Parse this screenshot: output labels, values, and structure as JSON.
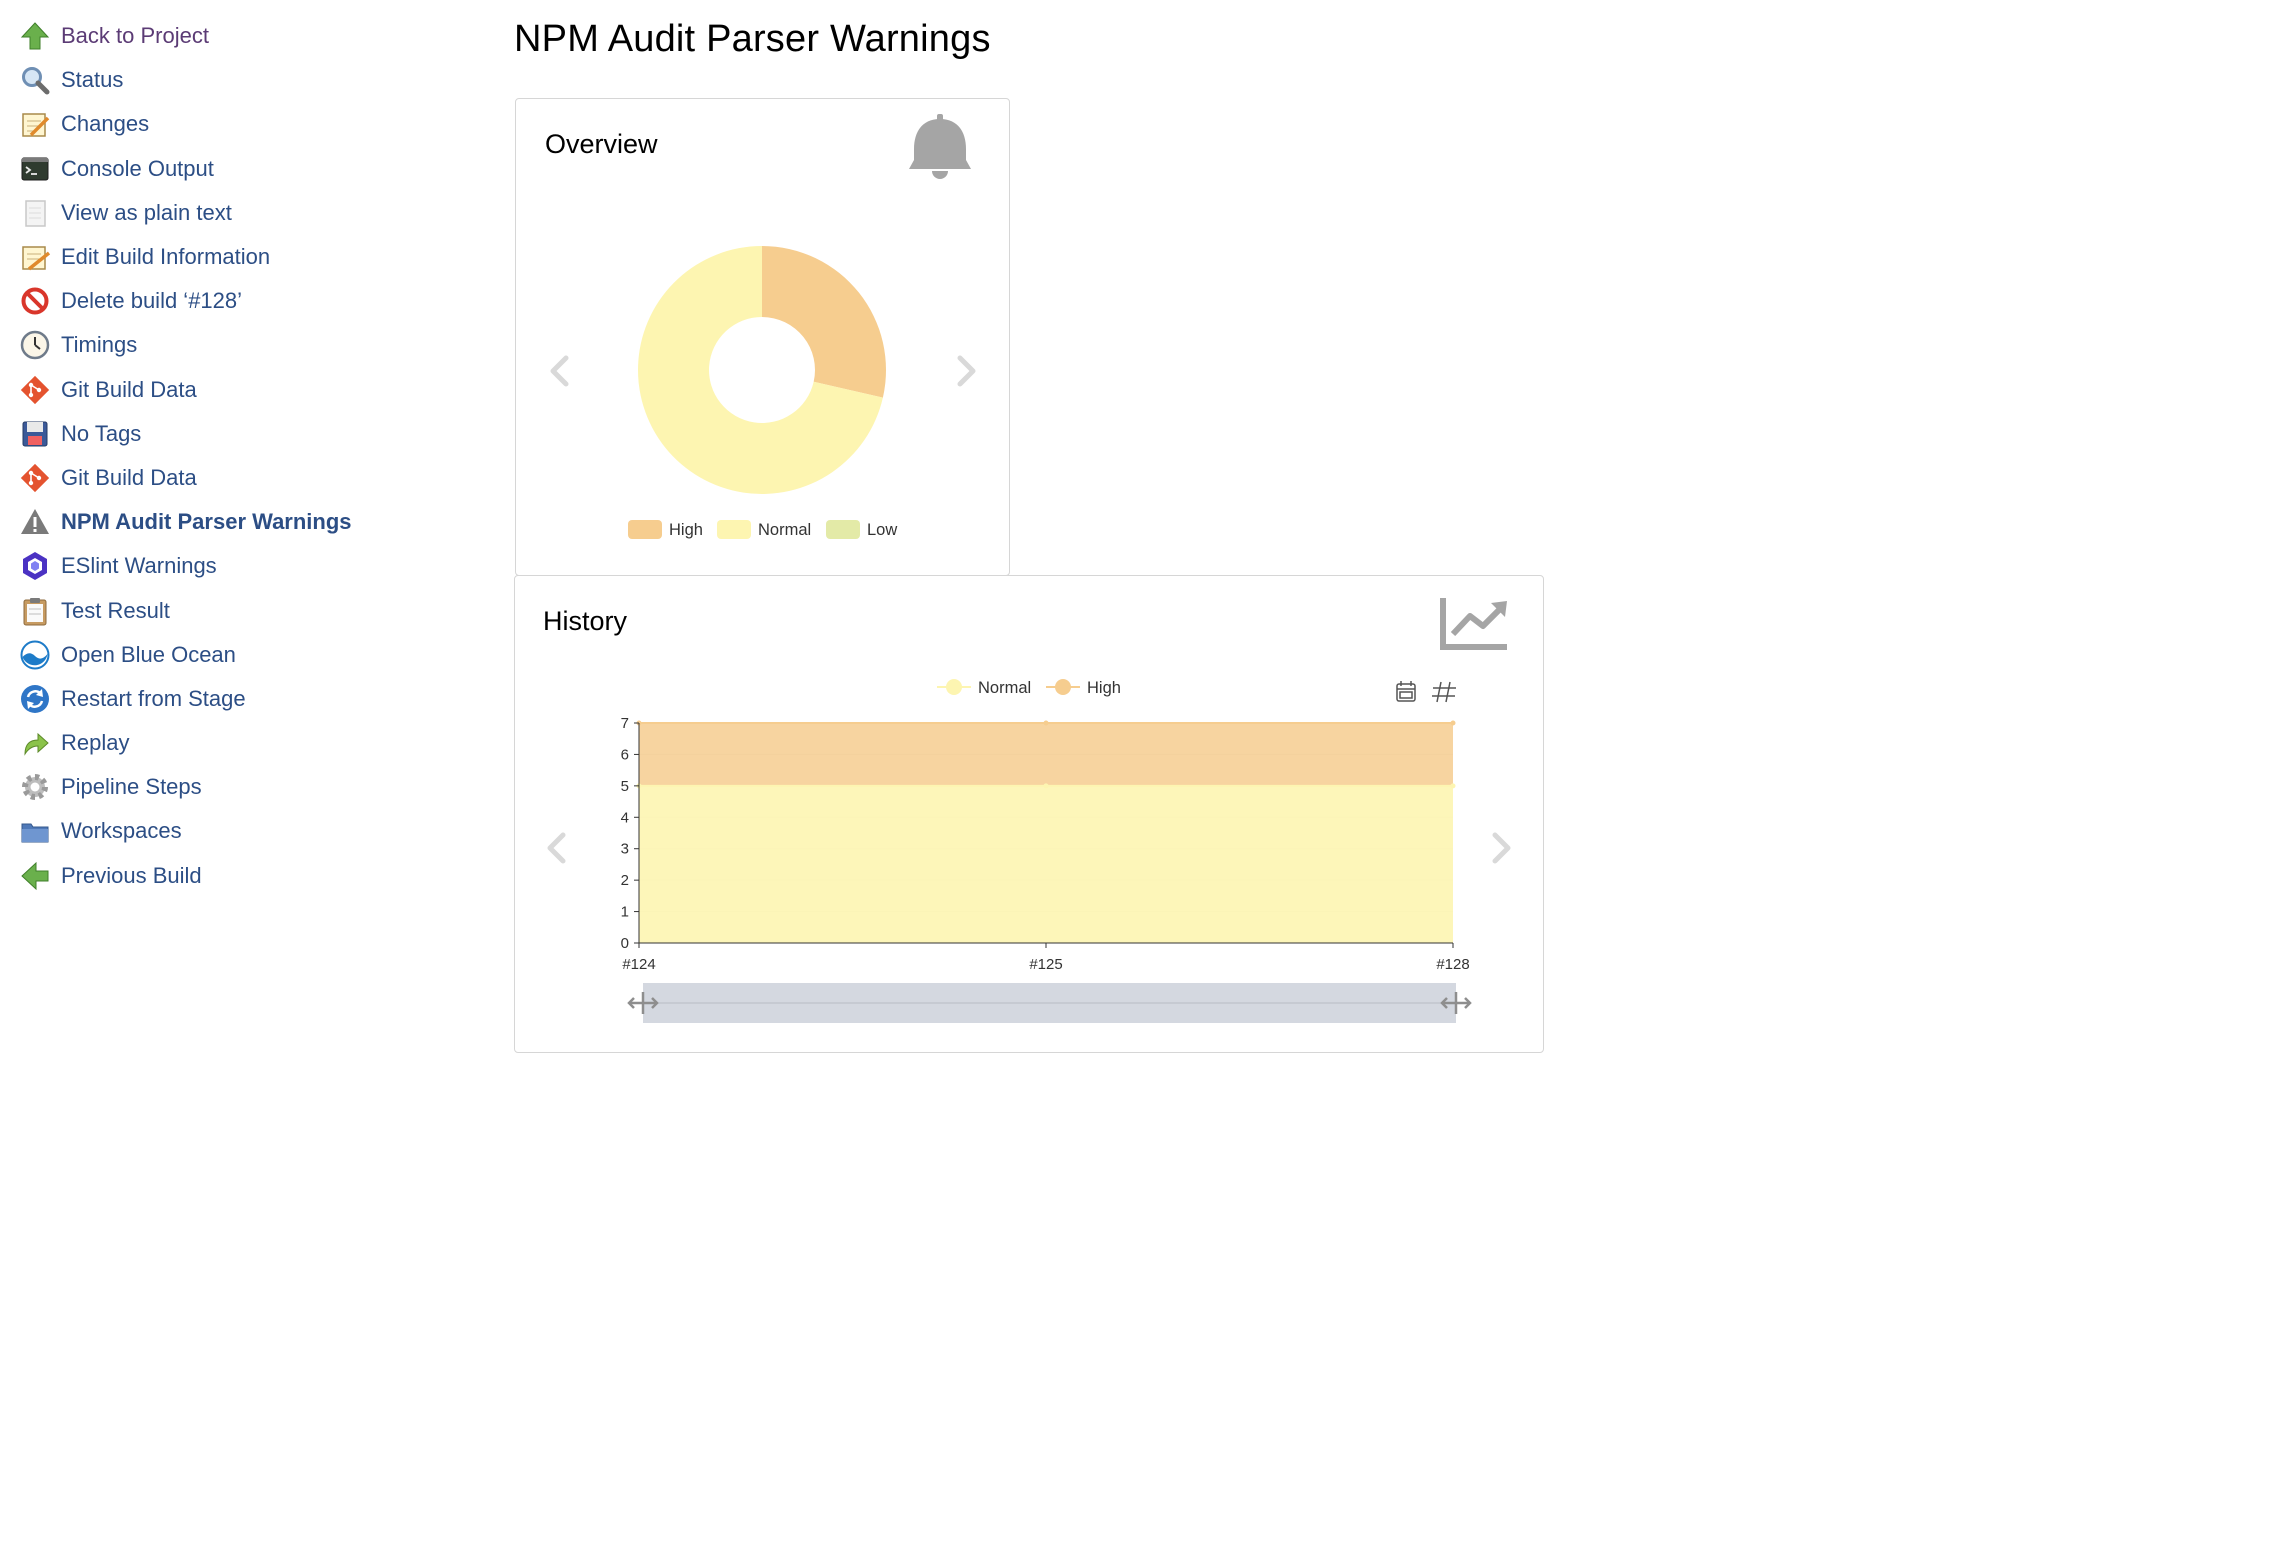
{
  "sidebar": {
    "items": [
      {
        "label": "Back to Project",
        "icon": "arrow-up-icon"
      },
      {
        "label": "Status",
        "icon": "magnifier-icon"
      },
      {
        "label": "Changes",
        "icon": "notepad-icon"
      },
      {
        "label": "Console Output",
        "icon": "terminal-icon"
      },
      {
        "label": "View as plain text",
        "icon": "document-icon"
      },
      {
        "label": "Edit Build Information",
        "icon": "notepad-pencil-icon"
      },
      {
        "label": "Delete build ‘#128’",
        "icon": "no-entry-icon"
      },
      {
        "label": "Timings",
        "icon": "clock-icon"
      },
      {
        "label": "Git Build Data",
        "icon": "git-icon"
      },
      {
        "label": "No Tags",
        "icon": "floppy-disk-icon"
      },
      {
        "label": "Git Build Data",
        "icon": "git-icon"
      },
      {
        "label": "NPM Audit Parser Warnings",
        "icon": "warning-triangle-icon",
        "active": true
      },
      {
        "label": "ESlint Warnings",
        "icon": "eslint-hexagon-icon"
      },
      {
        "label": "Test Result",
        "icon": "clipboard-icon"
      },
      {
        "label": "Open Blue Ocean",
        "icon": "blue-ocean-icon"
      },
      {
        "label": "Restart from Stage",
        "icon": "restart-icon"
      },
      {
        "label": "Replay",
        "icon": "replay-arrow-icon"
      },
      {
        "label": "Pipeline Steps",
        "icon": "gear-icon"
      },
      {
        "label": "Workspaces",
        "icon": "folder-icon"
      },
      {
        "label": "Previous Build",
        "icon": "arrow-left-icon"
      }
    ]
  },
  "page": {
    "title": "NPM Audit Parser Warnings"
  },
  "overview": {
    "title": "Overview",
    "icon": "bell-icon"
  },
  "history": {
    "title": "History",
    "icon": "trend-chart-icon",
    "toolbar_icons": [
      "calendar-icon",
      "hashtag-icon"
    ]
  },
  "colors": {
    "high": "#f6cd8f",
    "normal": "#fdf5b1",
    "low": "#e3eaa7",
    "nav_link": "#2c4e85",
    "nav_visited": "#5b3b75"
  },
  "chart_data": [
    {
      "type": "pie",
      "variant": "donut",
      "categories": [
        "High",
        "Normal",
        "Low"
      ],
      "values": [
        2,
        5,
        0
      ],
      "legend": [
        "High",
        "Normal",
        "Low"
      ],
      "legend_position": "bottom"
    },
    {
      "type": "area",
      "stacked": true,
      "x": [
        "#124",
        "#125",
        "#128"
      ],
      "series": [
        {
          "name": "Normal",
          "values": [
            5,
            5,
            5
          ]
        },
        {
          "name": "High",
          "values": [
            2,
            2,
            2
          ]
        }
      ],
      "ylim": [
        0,
        7
      ],
      "yticks": [
        0,
        1,
        2,
        3,
        4,
        5,
        6,
        7
      ],
      "grid": true,
      "legend_position": "top"
    }
  ]
}
